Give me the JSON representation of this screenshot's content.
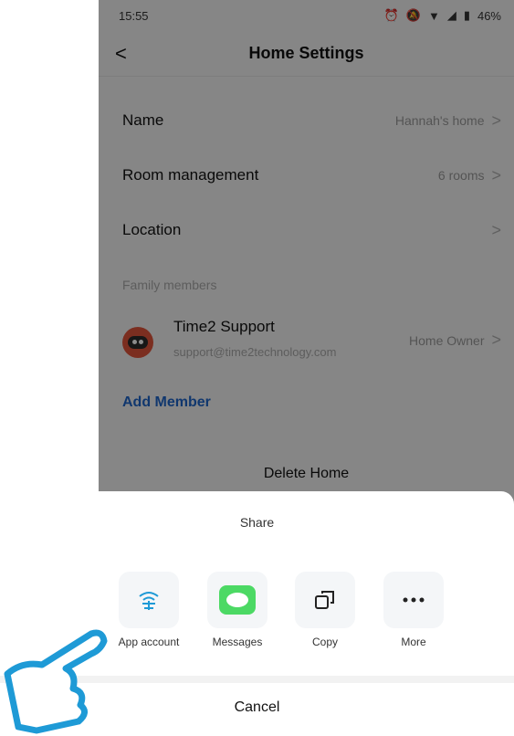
{
  "status": {
    "time": "15:55",
    "battery": "46%"
  },
  "header": {
    "title": "Home Settings"
  },
  "settings": {
    "name": {
      "label": "Name",
      "value": "Hannah's home"
    },
    "rooms": {
      "label": "Room management",
      "value": "6 rooms"
    },
    "location": {
      "label": "Location",
      "value": ""
    }
  },
  "family": {
    "section_label": "Family members",
    "member": {
      "name": "Time2 Support",
      "email": "support@time2technology.com",
      "role": "Home Owner"
    },
    "add_label": "Add Member"
  },
  "delete_label": "Delete Home",
  "share_sheet": {
    "title": "Share",
    "items": [
      {
        "label": "App account",
        "icon": "wifi-signal-icon"
      },
      {
        "label": "Messages",
        "icon": "messages-icon"
      },
      {
        "label": "Copy",
        "icon": "copy-icon"
      },
      {
        "label": "More",
        "icon": "more-icon"
      }
    ],
    "cancel": "Cancel"
  },
  "colors": {
    "link": "#1e64c8",
    "messages_green": "#4cd964",
    "hand_outline": "#1e9ad6"
  }
}
